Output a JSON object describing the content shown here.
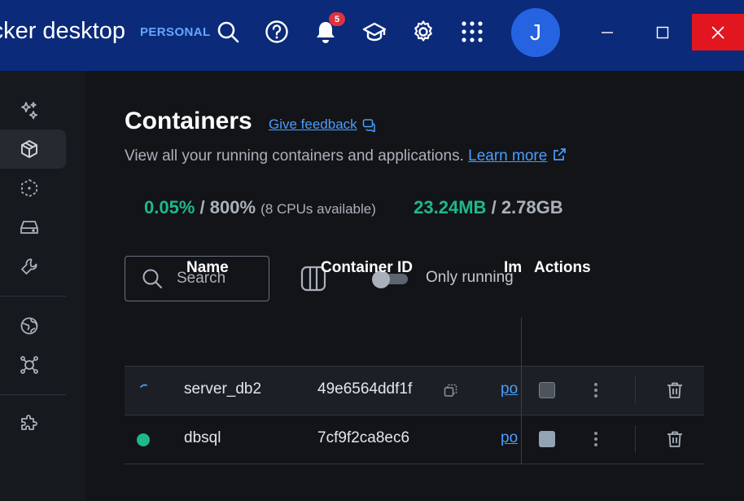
{
  "titlebar": {
    "brand": "docker desktop",
    "plan": "PERSONAL",
    "notification_count": "5",
    "avatar_initial": "J",
    "icons": [
      "search-icon",
      "help-icon",
      "bell-icon",
      "learning-center-icon",
      "gear-icon",
      "apps-grid-icon"
    ]
  },
  "sidebar": {
    "items": [
      {
        "icon": "sparkles-icon",
        "active": false
      },
      {
        "icon": "containers-icon",
        "active": true
      },
      {
        "icon": "images-icon",
        "active": false
      },
      {
        "icon": "volumes-icon",
        "active": false
      },
      {
        "icon": "builds-icon",
        "active": false
      },
      {
        "icon": "scout-icon",
        "active": false
      },
      {
        "icon": "extensions-hub-icon",
        "active": false
      },
      {
        "icon": "extensions-icon",
        "active": false
      }
    ]
  },
  "main": {
    "title": "Containers",
    "feedback_label": "Give feedback",
    "subtitle": "View all your running containers and applications.",
    "learn_more": "Learn more",
    "stats": {
      "cpu_used": "0.05%",
      "cpu_sep": "/",
      "cpu_total": "800%",
      "cpu_note": "(8 CPUs available)",
      "mem_used": "23.24MB",
      "mem_sep": "/",
      "mem_total": "2.78GB"
    },
    "search_placeholder": "Search",
    "only_running_label": "Only running",
    "only_running_on": false
  },
  "table": {
    "headers": {
      "name": "Name",
      "container_id": "Container ID",
      "image": "Im",
      "actions": "Actions"
    },
    "rows": [
      {
        "status": "starting",
        "name": "server_db2",
        "container_id": "49e6564ddf1f",
        "image": "po"
      },
      {
        "status": "running",
        "name": "dbsql",
        "container_id": "7cf9f2ca8ec6",
        "image": "po"
      }
    ]
  },
  "colors": {
    "titlebar": "#0b2a7a",
    "accent_link": "#4b9dff",
    "running_green": "#1eb88c",
    "close_red": "#e1161f"
  }
}
